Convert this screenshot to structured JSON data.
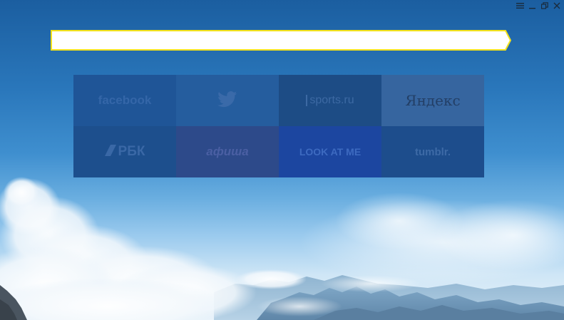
{
  "window": {
    "controls": [
      {
        "name": "menu-icon"
      },
      {
        "name": "minimize-icon"
      },
      {
        "name": "restore-icon"
      },
      {
        "name": "close-icon"
      }
    ]
  },
  "omnibox": {
    "value": "",
    "placeholder": "",
    "border_color": "#f3e21b"
  },
  "tableau": {
    "tiles": [
      {
        "label": "facebook",
        "bg": "#1f5597"
      },
      {
        "label": "",
        "icon": "twitter-bird-icon",
        "bg": "#255d9e"
      },
      {
        "label": "sports.ru",
        "bg": "#1d4c85"
      },
      {
        "label": "Яндекс",
        "bg": "#36659f"
      },
      {
        "label": "РБК",
        "icon": "rbk-logo-icon",
        "bg": "#1d4f8d"
      },
      {
        "label": "афиша",
        "bg": "#2d4a8a"
      },
      {
        "label": "LOOK AT ME",
        "bg": "#1c46a0"
      },
      {
        "label": "tumblr.",
        "bg": "#1d4d8c"
      }
    ]
  }
}
